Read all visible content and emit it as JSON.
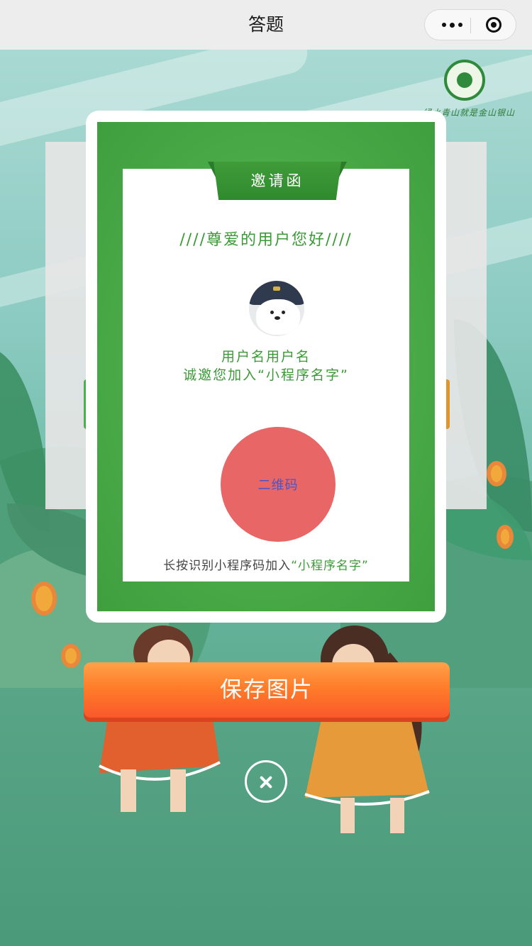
{
  "navbar": {
    "title": "答题",
    "more_icon": "more-dots-icon",
    "close_icon": "target-circle-icon"
  },
  "logo": {
    "slogan": "绿水青山就是金山银山"
  },
  "invitation": {
    "ribbon_label": "邀请函",
    "greeting": "////尊爱的用户您好////",
    "username": "用户名用户名",
    "invite_text": "诚邀您加入“小程序名字”",
    "qrcode_label": "二维码",
    "press_hint_prefix": "长按识别小程序码加入",
    "press_hint_app": "“小程序名字”"
  },
  "actions": {
    "save_label": "保存图片",
    "close_icon": "close-icon"
  },
  "colors": {
    "card_green": "#4aab48",
    "text_green": "#3a9a36",
    "qrcode_bg": "#e86666",
    "save_orange": "#ff7d2a"
  }
}
